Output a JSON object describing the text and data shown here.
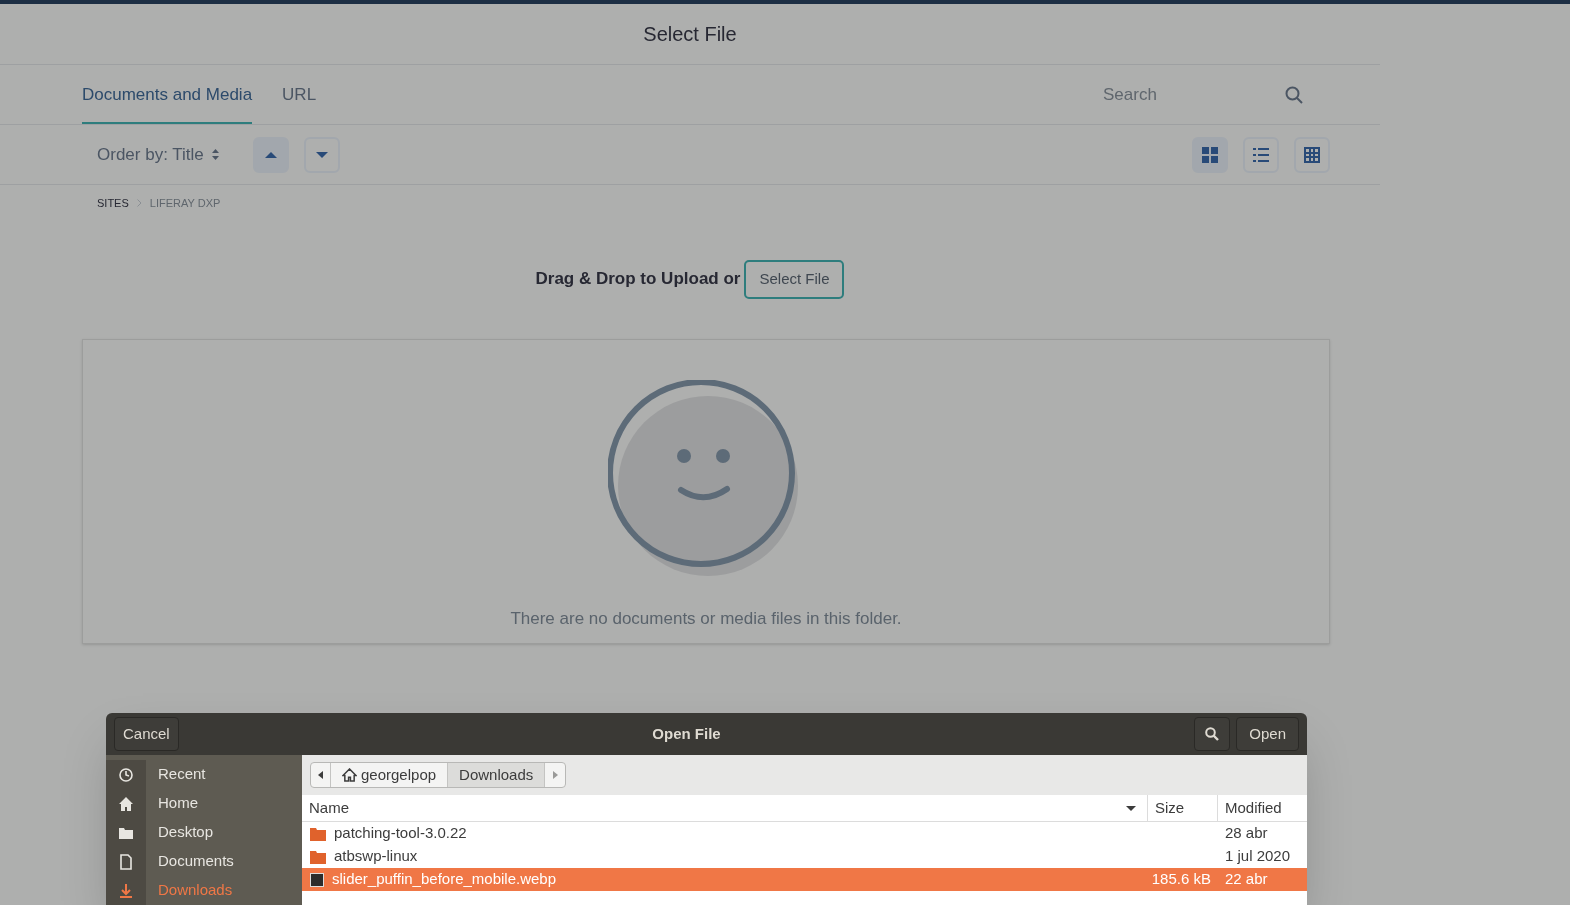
{
  "modal": {
    "title": "Select File"
  },
  "tabs": [
    {
      "label": "Documents and Media",
      "selected": true
    },
    {
      "label": "URL",
      "selected": false
    }
  ],
  "search": {
    "placeholder": "Search"
  },
  "toolbar": {
    "order_by": "Order by: Title",
    "sort": [
      {
        "kind": "up",
        "selected": true
      },
      {
        "kind": "down",
        "selected": false
      }
    ],
    "views": [
      {
        "kind": "cards",
        "selected": true
      },
      {
        "kind": "list",
        "selected": false
      },
      {
        "kind": "table",
        "selected": false
      }
    ]
  },
  "breadcrumb": [
    {
      "label": "SITES",
      "current": false
    },
    {
      "label": "LIFERAY DXP",
      "current": true
    }
  ],
  "upload": {
    "text": "Drag & Drop to Upload or",
    "button": "Select File"
  },
  "empty_state": {
    "message": "There are no documents or media files in this folder."
  },
  "file_dialog": {
    "title": "Open File",
    "cancel": "Cancel",
    "open": "Open",
    "places": [
      {
        "label": "Recent",
        "kind": "recent",
        "selected": false
      },
      {
        "label": "Home",
        "kind": "home",
        "selected": false
      },
      {
        "label": "Desktop",
        "kind": "desktop",
        "selected": false
      },
      {
        "label": "Documents",
        "kind": "documents",
        "selected": false
      },
      {
        "label": "Downloads",
        "kind": "downloads",
        "selected": true
      }
    ],
    "path": [
      {
        "label": "georgelpop",
        "kind": "home",
        "selected": false
      },
      {
        "label": "Downloads",
        "kind": "folder",
        "selected": true
      }
    ],
    "columns": [
      "Name",
      "Size",
      "Modified"
    ],
    "files": [
      {
        "name": "patching-tool-3.0.22",
        "kind": "folder",
        "modified": "28 abr",
        "selected": false
      },
      {
        "name": "atbswp-linux",
        "kind": "folder",
        "modified": "1 jul 2020",
        "selected": false
      },
      {
        "name": "slider_puffin_before_mobile.webp",
        "kind": "image",
        "size": "185.6 kB",
        "modified": "22 abr",
        "selected": true
      }
    ]
  }
}
